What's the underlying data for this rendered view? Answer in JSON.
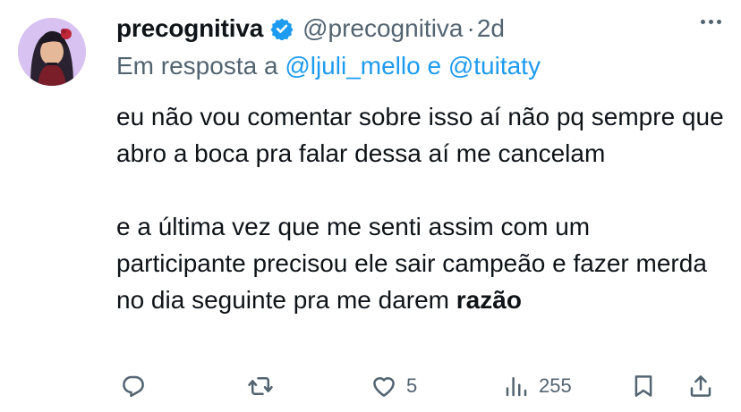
{
  "author": {
    "display_name": "precognitiva",
    "handle": "@precognitiva",
    "separator": "·",
    "time": "2d",
    "verified": true,
    "verified_color": "#1d9bf0"
  },
  "reply": {
    "prefix": "Em resposta a",
    "mention1": "@ljuli_mello",
    "joiner": "e",
    "mention2": "@tuitaty"
  },
  "body": {
    "paragraph1": "eu não vou comentar sobre isso aí não pq sempre que abro a boca pra falar dessa aí me cancelam",
    "paragraph2_text": "e a última vez que me senti assim com um participante precisou ele sair campeão e fazer merda no dia seguinte pra me darem",
    "paragraph2_bold": "razão"
  },
  "actions": {
    "reply_icon": "reply-icon",
    "retweet_icon": "retweet-icon",
    "like_icon": "heart-icon",
    "like_count": "5",
    "views_icon": "views-icon",
    "views_count": "255",
    "bookmark_icon": "bookmark-icon",
    "share_icon": "share-icon"
  },
  "colors": {
    "text": "#0f1419",
    "secondary": "#536471",
    "link": "#1d9bf0"
  }
}
